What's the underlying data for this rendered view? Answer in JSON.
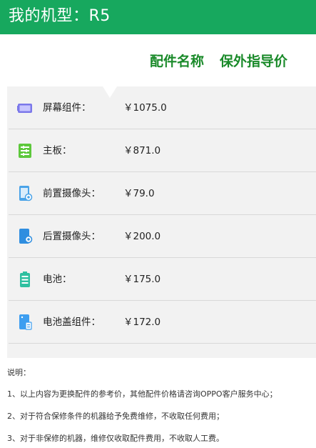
{
  "header": {
    "title": "我的机型：R5"
  },
  "columns": {
    "part_name": "配件名称",
    "price": "保外指导价"
  },
  "parts": [
    {
      "name": "屏幕组件：",
      "price": "￥1075.0",
      "icon": "screen-icon"
    },
    {
      "name": "主板：",
      "price": "￥871.0",
      "icon": "mainboard-icon"
    },
    {
      "name": "前置摄像头：",
      "price": "￥79.0",
      "icon": "front-camera-icon"
    },
    {
      "name": "后置摄像头：",
      "price": "￥200.0",
      "icon": "rear-camera-icon"
    },
    {
      "name": "电池：",
      "price": "￥175.0",
      "icon": "battery-icon"
    },
    {
      "name": "电池盖组件：",
      "price": "￥172.0",
      "icon": "battery-cover-icon"
    }
  ],
  "notes": {
    "title": "说明：",
    "items": [
      "1、以上内容为更换配件的参考价，其他配件价格请咨询OPPO客户服务中心；",
      "2、对于符合保修条件的机器给予免费维修，不收取任何费用；",
      "3、对于非保修的机器，维修仅收取配件费用，不收取人工费。"
    ]
  },
  "colors": {
    "header_bg": "#17a85e",
    "column_text": "#1a8a2a",
    "panel_bg": "#f2f2f2"
  }
}
